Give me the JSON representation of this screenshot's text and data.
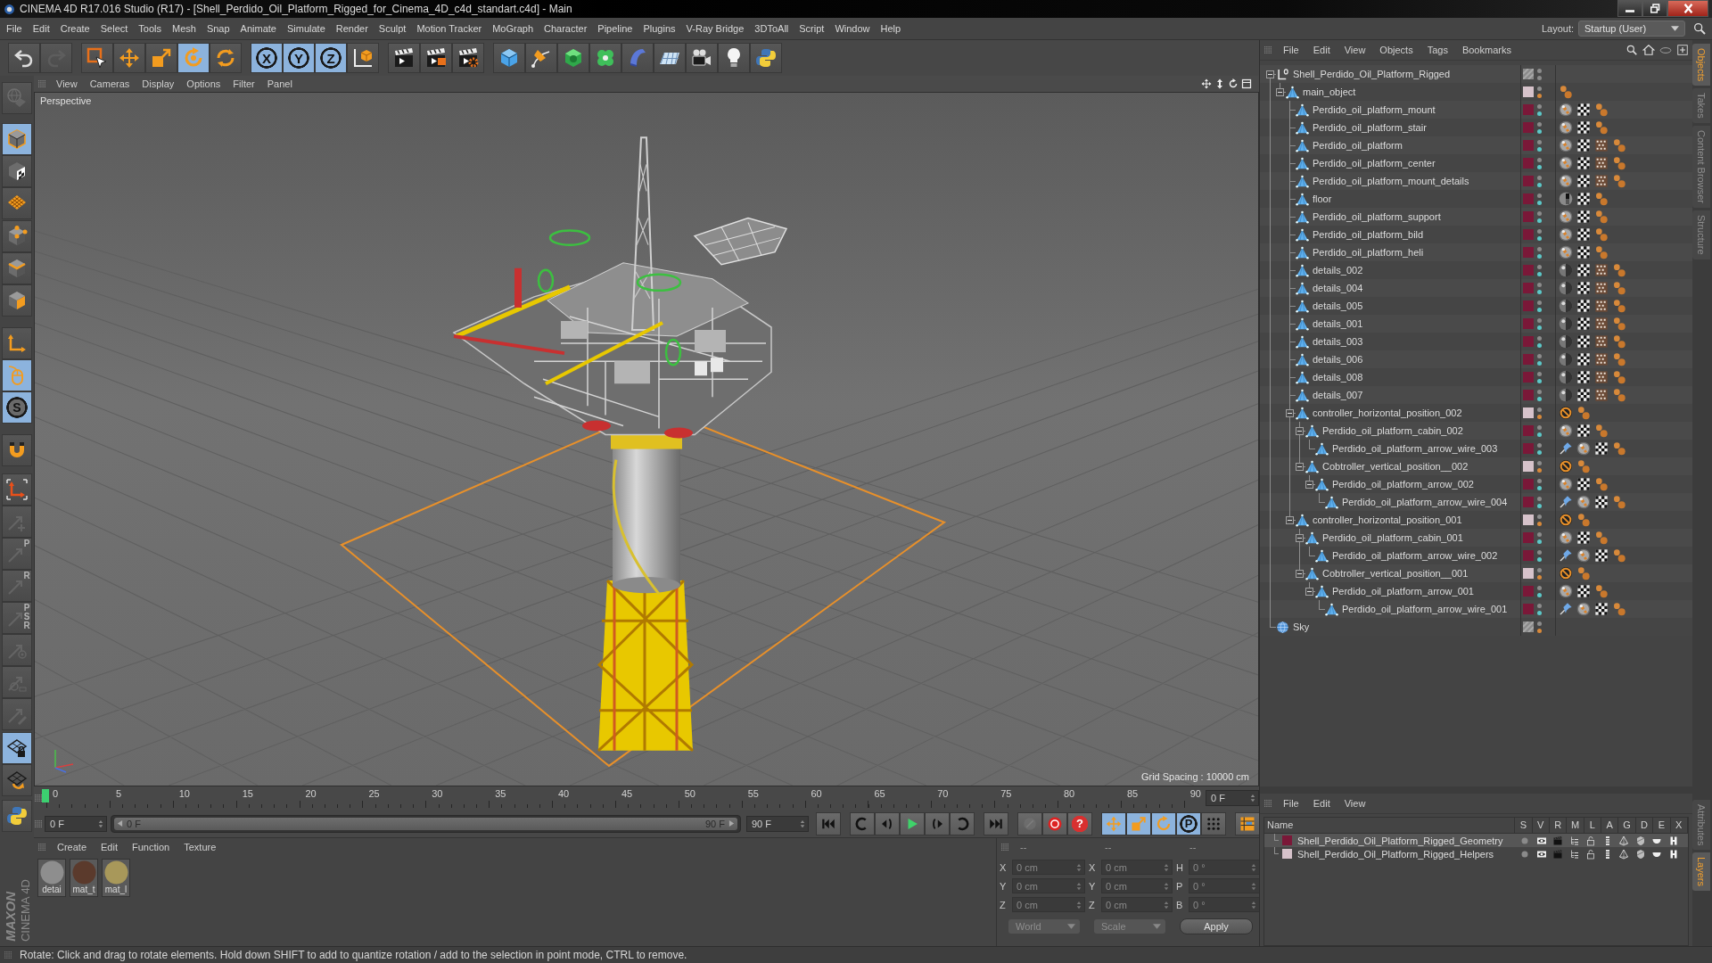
{
  "window": {
    "title": "CINEMA 4D R17.016 Studio (R17) - [Shell_Perdido_Oil_Platform_Rigged_for_Cinema_4D_c4d_standart.c4d] - Main"
  },
  "menu_bar": {
    "items": [
      "File",
      "Edit",
      "Create",
      "Select",
      "Tools",
      "Mesh",
      "Snap",
      "Animate",
      "Simulate",
      "Render",
      "Sculpt",
      "Motion Tracker",
      "MoGraph",
      "Character",
      "Pipeline",
      "Plugins",
      "V-Ray Bridge",
      "3DToAll",
      "Script",
      "Window",
      "Help"
    ],
    "layout_label": "Layout:",
    "layout_value": "Startup (User)"
  },
  "toolbar": [
    [
      {
        "kind": "undo",
        "selected": false,
        "disabled": false
      },
      {
        "kind": "redo",
        "selected": false,
        "disabled": true
      }
    ],
    [
      {
        "kind": "select",
        "selected": false,
        "disabled": false
      },
      {
        "kind": "move",
        "selected": false,
        "disabled": false
      },
      {
        "kind": "scale",
        "selected": false,
        "disabled": false
      },
      {
        "kind": "rotate",
        "selected": true,
        "disabled": false
      },
      {
        "kind": "recent",
        "selected": false,
        "disabled": false
      }
    ],
    [
      {
        "kind": "axis",
        "label": "X",
        "selected": true,
        "disabled": false
      },
      {
        "kind": "axis",
        "label": "Y",
        "selected": true,
        "disabled": false
      },
      {
        "kind": "axis",
        "label": "Z",
        "selected": true,
        "disabled": false
      },
      {
        "kind": "coords",
        "selected": false,
        "disabled": false
      }
    ],
    [
      {
        "kind": "render-view",
        "selected": false,
        "disabled": false
      },
      {
        "kind": "render-picture",
        "selected": false,
        "disabled": false
      },
      {
        "kind": "render-settings",
        "selected": false,
        "disabled": false
      }
    ],
    [
      {
        "kind": "cube",
        "selected": false,
        "disabled": false
      },
      {
        "kind": "pen",
        "selected": false,
        "disabled": false
      },
      {
        "kind": "subdivision",
        "selected": false,
        "disabled": false
      },
      {
        "kind": "cloner",
        "selected": false,
        "disabled": false
      },
      {
        "kind": "deformer",
        "selected": false,
        "disabled": false
      },
      {
        "kind": "floor",
        "selected": false,
        "disabled": false
      },
      {
        "kind": "camera",
        "selected": false,
        "disabled": false
      },
      {
        "kind": "light",
        "selected": false,
        "disabled": false
      },
      {
        "kind": "python",
        "selected": false,
        "disabled": false
      }
    ]
  ],
  "left_toolbar": [
    [
      {
        "kind": "make-editable",
        "selected": false,
        "disabled": true
      }
    ],
    [
      {
        "kind": "model",
        "selected": true,
        "disabled": false
      },
      {
        "kind": "texture",
        "selected": false,
        "disabled": false
      },
      {
        "kind": "workplane",
        "selected": false,
        "disabled": false
      }
    ],
    [
      {
        "kind": "points",
        "selected": false,
        "disabled": false
      },
      {
        "kind": "edges",
        "selected": false,
        "disabled": false
      },
      {
        "kind": "polygons",
        "selected": false,
        "disabled": false
      }
    ],
    [
      {
        "kind": "axis-mode",
        "selected": false,
        "disabled": false
      },
      {
        "kind": "tweak",
        "selected": true,
        "disabled": false
      },
      {
        "kind": "snap",
        "label": "S",
        "selected": true,
        "disabled": false
      }
    ],
    [
      {
        "kind": "magnet",
        "selected": false,
        "disabled": false
      }
    ],
    [
      {
        "kind": "axis-corner",
        "selected": false,
        "disabled": false
      },
      {
        "kind": "key-all",
        "selected": false,
        "disabled": true
      },
      {
        "kind": "key-position",
        "label": "P",
        "selected": false,
        "disabled": true
      },
      {
        "kind": "key-rotation",
        "label": "R",
        "selected": false,
        "disabled": true
      },
      {
        "kind": "key-psr",
        "label": "P S R",
        "selected": false,
        "disabled": true
      },
      {
        "kind": "key-param",
        "selected": false,
        "disabled": true
      },
      {
        "kind": "key-point",
        "selected": false,
        "disabled": true
      },
      {
        "kind": "key-pla",
        "selected": false,
        "disabled": true
      }
    ],
    [
      {
        "kind": "workplane-lock",
        "selected": true,
        "disabled": false
      },
      {
        "kind": "workplane-rotate",
        "selected": false,
        "disabled": false
      }
    ],
    [
      {
        "kind": "python",
        "selected": false,
        "disabled": false
      }
    ]
  ],
  "viewport": {
    "menu": [
      "View",
      "Cameras",
      "Display",
      "Options",
      "Filter",
      "Panel"
    ],
    "camera": "Perspective",
    "grid_spacing": "Grid Spacing : 10000 cm"
  },
  "timeline": {
    "ruler": [
      "0",
      "5",
      "10",
      "15",
      "20",
      "25",
      "30",
      "35",
      "40",
      "45",
      "50",
      "55",
      "60",
      "65",
      "70",
      "75",
      "80",
      "85",
      "90"
    ],
    "playhead": {
      "level": 0
    },
    "current_frame": "0 F"
  },
  "playback": {
    "start_field": "0 F",
    "range": {
      "start": "0 F",
      "end": "90 F",
      "level": 1
    },
    "end_field": "90 F",
    "transport": [
      {
        "kind": "first"
      },
      {
        "kind": "prev-key"
      },
      {
        "kind": "prev-frame"
      },
      {
        "kind": "play"
      },
      {
        "kind": "next-frame"
      },
      {
        "kind": "next-key"
      },
      {
        "kind": "last"
      }
    ],
    "key_tools": [
      {
        "kind": "key-off",
        "selected": false,
        "disabled": true
      },
      {
        "kind": "record",
        "selected": false,
        "disabled": false
      },
      {
        "kind": "autokey",
        "label": "?",
        "selected": false,
        "disabled": false
      },
      {
        "kind": "key-move",
        "selected": true,
        "disabled": false
      },
      {
        "kind": "key-scale",
        "selected": true,
        "disabled": false
      },
      {
        "kind": "key-rotate",
        "selected": true,
        "disabled": false
      },
      {
        "kind": "key-p",
        "label": "P",
        "selected": true,
        "disabled": false
      },
      {
        "kind": "key-dots",
        "selected": false,
        "disabled": false
      },
      {
        "kind": "timeline",
        "selected": false,
        "disabled": false
      }
    ]
  },
  "material_manager": {
    "menu": [
      "Create",
      "Edit",
      "Function",
      "Texture"
    ],
    "materials": [
      {
        "name": "detai",
        "color": "#8e8e8e"
      },
      {
        "name": "mat_t",
        "color": "#5b3a2c"
      },
      {
        "name": "mat_l",
        "color": "#a8985a"
      }
    ]
  },
  "coordinates": {
    "headers": [
      "--",
      "--",
      "--"
    ],
    "rows": [
      [
        {
          "axis": "X",
          "value": "0 cm"
        },
        {
          "axis": "X",
          "value": "0 cm"
        },
        {
          "axis": "H",
          "value": "0 °"
        }
      ],
      [
        {
          "axis": "Y",
          "value": "0 cm"
        },
        {
          "axis": "Y",
          "value": "0 cm"
        },
        {
          "axis": "P",
          "value": "0 °"
        }
      ],
      [
        {
          "axis": "Z",
          "value": "0 cm"
        },
        {
          "axis": "Z",
          "value": "0 cm"
        },
        {
          "axis": "B",
          "value": "0 °"
        }
      ]
    ],
    "space": "World",
    "mode": "Scale",
    "apply": "Apply"
  },
  "object_manager": {
    "menu": [
      "File",
      "Edit",
      "View",
      "Objects",
      "Tags",
      "Bookmarks"
    ],
    "objects": [
      {
        "name": "Shell_Perdido_Oil_Platform_Rigged",
        "kind": "null",
        "expanded": true,
        "dot": {
          "color": "#8c8c8c"
        },
        "children": [
          {
            "name": "main_object",
            "kind": "polygon",
            "expanded": true,
            "layer": {
              "color": "#d6c2ca"
            },
            "dot": {
              "color": "#d8893a"
            },
            "tags": [
              {
                "kind": "phong"
              }
            ],
            "children": [
              {
                "name": "Perdido_oil_platform_mount",
                "kind": "polygon",
                "layer": {
                  "color": "#7a1838"
                },
                "dot": {
                  "color": "#5cc8c8"
                },
                "tags": [
                  {
                    "kind": "material"
                  },
                  {
                    "kind": "checker"
                  },
                  {
                    "kind": "phong"
                  }
                ]
              },
              {
                "name": "Perdido_oil_platform_stair",
                "kind": "polygon",
                "layer": {
                  "color": "#7a1838"
                },
                "dot": {
                  "color": "#5cc8c8"
                },
                "tags": [
                  {
                    "kind": "material"
                  },
                  {
                    "kind": "checker"
                  },
                  {
                    "kind": "phong"
                  }
                ]
              },
              {
                "name": "Perdido_oil_platform",
                "kind": "polygon",
                "layer": {
                  "color": "#7a1838"
                },
                "dot": {
                  "color": "#5cc8c8"
                },
                "tags": [
                  {
                    "kind": "material"
                  },
                  {
                    "kind": "checker"
                  },
                  {
                    "kind": "pattern"
                  },
                  {
                    "kind": "phong"
                  }
                ]
              },
              {
                "name": "Perdido_oil_platform_center",
                "kind": "polygon",
                "layer": {
                  "color": "#7a1838"
                },
                "dot": {
                  "color": "#5cc8c8"
                },
                "tags": [
                  {
                    "kind": "material"
                  },
                  {
                    "kind": "checker"
                  },
                  {
                    "kind": "pattern"
                  },
                  {
                    "kind": "phong"
                  }
                ]
              },
              {
                "name": "Perdido_oil_platform_mount_details",
                "kind": "polygon",
                "layer": {
                  "color": "#7a1838"
                },
                "dot": {
                  "color": "#5cc8c8"
                },
                "tags": [
                  {
                    "kind": "material"
                  },
                  {
                    "kind": "checker"
                  },
                  {
                    "kind": "pattern"
                  },
                  {
                    "kind": "phong"
                  }
                ]
              },
              {
                "name": "floor",
                "kind": "polygon",
                "layer": {
                  "color": "#7a1838"
                },
                "dot": {
                  "color": "#5cc8c8"
                },
                "tags": [
                  {
                    "kind": "material-dark"
                  },
                  {
                    "kind": "checker"
                  },
                  {
                    "kind": "phong"
                  }
                ]
              },
              {
                "name": "Perdido_oil_platform_support",
                "kind": "polygon",
                "layer": {
                  "color": "#7a1838"
                },
                "dot": {
                  "color": "#5cc8c8"
                },
                "tags": [
                  {
                    "kind": "material"
                  },
                  {
                    "kind": "checker"
                  },
                  {
                    "kind": "phong"
                  }
                ]
              },
              {
                "name": "Perdido_oil_platform_bild",
                "kind": "polygon",
                "layer": {
                  "color": "#7a1838"
                },
                "dot": {
                  "color": "#5cc8c8"
                },
                "tags": [
                  {
                    "kind": "material"
                  },
                  {
                    "kind": "checker"
                  },
                  {
                    "kind": "phong"
                  }
                ]
              },
              {
                "name": "Perdido_oil_platform_heli",
                "kind": "polygon",
                "layer": {
                  "color": "#7a1838"
                },
                "dot": {
                  "color": "#5cc8c8"
                },
                "tags": [
                  {
                    "kind": "material"
                  },
                  {
                    "kind": "checker"
                  },
                  {
                    "kind": "phong"
                  }
                ]
              },
              {
                "name": "details_002",
                "kind": "polygon",
                "layer": {
                  "color": "#7a1838"
                },
                "dot": {
                  "color": "#5cc8c8"
                },
                "tags": [
                  {
                    "kind": "material-gray"
                  },
                  {
                    "kind": "checker"
                  },
                  {
                    "kind": "pattern"
                  },
                  {
                    "kind": "phong"
                  }
                ]
              },
              {
                "name": "details_004",
                "kind": "polygon",
                "layer": {
                  "color": "#7a1838"
                },
                "dot": {
                  "color": "#5cc8c8"
                },
                "tags": [
                  {
                    "kind": "material-gray"
                  },
                  {
                    "kind": "checker"
                  },
                  {
                    "kind": "pattern"
                  },
                  {
                    "kind": "phong"
                  }
                ]
              },
              {
                "name": "details_005",
                "kind": "polygon",
                "layer": {
                  "color": "#7a1838"
                },
                "dot": {
                  "color": "#5cc8c8"
                },
                "tags": [
                  {
                    "kind": "material-gray"
                  },
                  {
                    "kind": "checker"
                  },
                  {
                    "kind": "pattern"
                  },
                  {
                    "kind": "phong"
                  }
                ]
              },
              {
                "name": "details_001",
                "kind": "polygon",
                "layer": {
                  "color": "#7a1838"
                },
                "dot": {
                  "color": "#5cc8c8"
                },
                "tags": [
                  {
                    "kind": "material-gray"
                  },
                  {
                    "kind": "checker"
                  },
                  {
                    "kind": "pattern"
                  },
                  {
                    "kind": "phong"
                  }
                ]
              },
              {
                "name": "details_003",
                "kind": "polygon",
                "layer": {
                  "color": "#7a1838"
                },
                "dot": {
                  "color": "#5cc8c8"
                },
                "tags": [
                  {
                    "kind": "material-gray"
                  },
                  {
                    "kind": "checker"
                  },
                  {
                    "kind": "pattern"
                  },
                  {
                    "kind": "phong"
                  }
                ]
              },
              {
                "name": "details_006",
                "kind": "polygon",
                "layer": {
                  "color": "#7a1838"
                },
                "dot": {
                  "color": "#5cc8c8"
                },
                "tags": [
                  {
                    "kind": "material-gray"
                  },
                  {
                    "kind": "checker"
                  },
                  {
                    "kind": "pattern"
                  },
                  {
                    "kind": "phong"
                  }
                ]
              },
              {
                "name": "details_008",
                "kind": "polygon",
                "layer": {
                  "color": "#7a1838"
                },
                "dot": {
                  "color": "#5cc8c8"
                },
                "tags": [
                  {
                    "kind": "material-gray"
                  },
                  {
                    "kind": "checker"
                  },
                  {
                    "kind": "pattern"
                  },
                  {
                    "kind": "phong"
                  }
                ]
              },
              {
                "name": "details_007",
                "kind": "polygon",
                "layer": {
                  "color": "#7a1838"
                },
                "dot": {
                  "color": "#5cc8c8"
                },
                "tags": [
                  {
                    "kind": "material-gray"
                  },
                  {
                    "kind": "checker"
                  },
                  {
                    "kind": "pattern"
                  },
                  {
                    "kind": "phong"
                  }
                ]
              },
              {
                "name": "controller_horizontal_position_002",
                "kind": "polygon",
                "expanded": true,
                "layer": {
                  "color": "#d6c2ca"
                },
                "dot": {
                  "color": "#d8893a"
                },
                "tags": [
                  {
                    "kind": "restrict"
                  },
                  {
                    "kind": "phong"
                  }
                ],
                "children": [
                  {
                    "name": "Perdido_oil_platform_cabin_002",
                    "kind": "polygon",
                    "expanded": true,
                    "layer": {
                      "color": "#7a1838"
                    },
                    "dot": {
                      "color": "#5cc8c8"
                    },
                    "tags": [
                      {
                        "kind": "material"
                      },
                      {
                        "kind": "checker"
                      },
                      {
                        "kind": "phong"
                      }
                    ],
                    "children": [
                      {
                        "name": "Perdido_oil_platform_arrow_wire_003",
                        "kind": "polygon",
                        "layer": {
                          "color": "#7a1838"
                        },
                        "dot": {
                          "color": "#5cc8c8"
                        },
                        "tags": [
                          {
                            "kind": "pin"
                          },
                          {
                            "kind": "material"
                          },
                          {
                            "kind": "checker"
                          },
                          {
                            "kind": "phong"
                          }
                        ]
                      }
                    ]
                  },
                  {
                    "name": "Cobtroller_vertical_position__002",
                    "kind": "polygon",
                    "expanded": true,
                    "layer": {
                      "color": "#d6c2ca"
                    },
                    "dot": {
                      "color": "#d8893a"
                    },
                    "tags": [
                      {
                        "kind": "restrict"
                      },
                      {
                        "kind": "phong"
                      }
                    ],
                    "children": [
                      {
                        "name": "Perdido_oil_platform_arrow_002",
                        "kind": "polygon",
                        "expanded": true,
                        "layer": {
                          "color": "#7a1838"
                        },
                        "dot": {
                          "color": "#5cc8c8"
                        },
                        "tags": [
                          {
                            "kind": "material"
                          },
                          {
                            "kind": "checker"
                          },
                          {
                            "kind": "phong"
                          }
                        ],
                        "children": [
                          {
                            "name": "Perdido_oil_platform_arrow_wire_004",
                            "kind": "polygon",
                            "layer": {
                              "color": "#7a1838"
                            },
                            "dot": {
                              "color": "#5cc8c8"
                            },
                            "tags": [
                              {
                                "kind": "pin"
                              },
                              {
                                "kind": "material"
                              },
                              {
                                "kind": "checker"
                              },
                              {
                                "kind": "phong"
                              }
                            ]
                          }
                        ]
                      }
                    ]
                  }
                ]
              },
              {
                "name": "controller_horizontal_position_001",
                "kind": "polygon",
                "expanded": true,
                "layer": {
                  "color": "#d6c2ca"
                },
                "dot": {
                  "color": "#d8893a"
                },
                "tags": [
                  {
                    "kind": "restrict"
                  },
                  {
                    "kind": "phong"
                  }
                ],
                "children": [
                  {
                    "name": "Perdido_oil_platform_cabin_001",
                    "kind": "polygon",
                    "expanded": true,
                    "layer": {
                      "color": "#7a1838"
                    },
                    "dot": {
                      "color": "#5cc8c8"
                    },
                    "tags": [
                      {
                        "kind": "material"
                      },
                      {
                        "kind": "checker"
                      },
                      {
                        "kind": "phong"
                      }
                    ],
                    "children": [
                      {
                        "name": "Perdido_oil_platform_arrow_wire_002",
                        "kind": "polygon",
                        "layer": {
                          "color": "#7a1838"
                        },
                        "dot": {
                          "color": "#5cc8c8"
                        },
                        "tags": [
                          {
                            "kind": "pin"
                          },
                          {
                            "kind": "material"
                          },
                          {
                            "kind": "checker"
                          },
                          {
                            "kind": "phong"
                          }
                        ]
                      }
                    ]
                  },
                  {
                    "name": "Cobtroller_vertical_position__001",
                    "kind": "polygon",
                    "expanded": true,
                    "layer": {
                      "color": "#d6c2ca"
                    },
                    "dot": {
                      "color": "#d8893a"
                    },
                    "tags": [
                      {
                        "kind": "restrict"
                      },
                      {
                        "kind": "phong"
                      }
                    ],
                    "children": [
                      {
                        "name": "Perdido_oil_platform_arrow_001",
                        "kind": "polygon",
                        "expanded": true,
                        "layer": {
                          "color": "#7a1838"
                        },
                        "dot": {
                          "color": "#5cc8c8"
                        },
                        "tags": [
                          {
                            "kind": "material"
                          },
                          {
                            "kind": "checker"
                          },
                          {
                            "kind": "phong"
                          }
                        ],
                        "children": [
                          {
                            "name": "Perdido_oil_platform_arrow_wire_001",
                            "kind": "polygon",
                            "layer": {
                              "color": "#7a1838"
                            },
                            "dot": {
                              "color": "#5cc8c8"
                            },
                            "tags": [
                              {
                                "kind": "pin"
                              },
                              {
                                "kind": "material"
                              },
                              {
                                "kind": "checker"
                              },
                              {
                                "kind": "phong"
                              }
                            ]
                          }
                        ]
                      }
                    ]
                  }
                ]
              }
            ]
          }
        ]
      },
      {
        "name": "Sky",
        "kind": "sky",
        "dot": {
          "color": "#d8893a"
        }
      }
    ]
  },
  "layer_manager": {
    "menu": [
      "File",
      "Edit",
      "View"
    ],
    "columns": [
      {
        "label": "Name",
        "kind": "name"
      },
      {
        "label": "S",
        "kind": "solo"
      },
      {
        "label": "V",
        "kind": "visible"
      },
      {
        "label": "R",
        "kind": "render"
      },
      {
        "label": "M",
        "kind": "manager"
      },
      {
        "label": "L",
        "kind": "locked"
      },
      {
        "label": "A",
        "kind": "animation"
      },
      {
        "label": "G",
        "kind": "generators"
      },
      {
        "label": "D",
        "kind": "deformers"
      },
      {
        "label": "E",
        "kind": "expressions"
      },
      {
        "label": "X",
        "kind": "xref"
      }
    ],
    "layers": [
      {
        "name": "Shell_Perdido_Oil_Platform_Rigged_Geometry",
        "color": "#7a1838",
        "selected": true
      },
      {
        "name": "Shell_Perdido_Oil_Platform_Rigged_Helpers",
        "color": "#d6c2ca",
        "selected": false
      }
    ]
  },
  "side_tabs": {
    "top": [
      {
        "label": "Objects",
        "selected": true
      },
      {
        "label": "Takes",
        "selected": false
      },
      {
        "label": "Content Browser",
        "selected": false
      },
      {
        "label": "Structure",
        "selected": false
      }
    ],
    "bottom": [
      {
        "label": "Attributes",
        "selected": false
      },
      {
        "label": "Layers",
        "selected": true
      }
    ]
  },
  "logo": {
    "brand": "MAXON",
    "product": "CINEMA 4D"
  },
  "status_bar": {
    "text": "Rotate: Click and drag to rotate elements. Hold down SHIFT to add to quantize rotation / add to the selection in point mode, CTRL to remove."
  }
}
